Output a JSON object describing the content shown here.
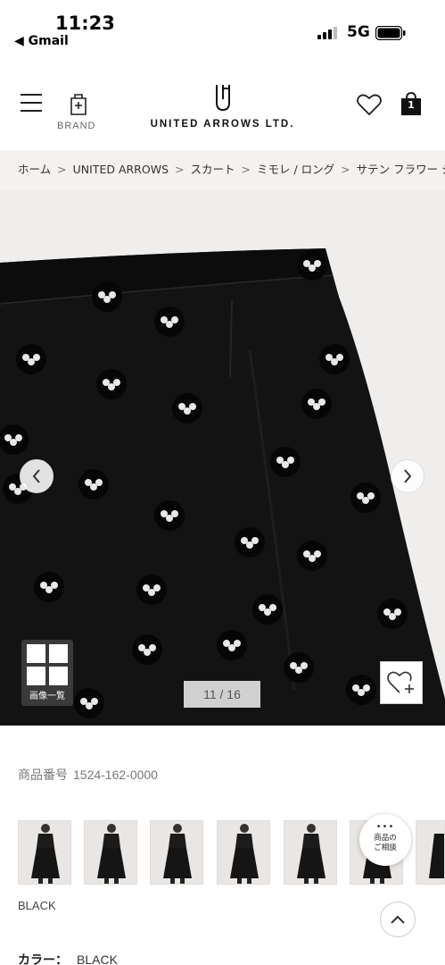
{
  "status_bar": {
    "time": "11:23",
    "back_app": "◀ Gmail",
    "network": "5G"
  },
  "header": {
    "brand_label": "BRAND",
    "logo_text": "UNITED ARROWS LTD.",
    "cart_count": "1"
  },
  "breadcrumb": {
    "items": [
      "ホーム",
      "UNITED ARROWS",
      "スカート",
      "ミモレ / ロング",
      "サテン フラワー ジ"
    ],
    "separator": ">"
  },
  "gallery": {
    "image_list_label": "画像一覧",
    "counter": "11 / 16"
  },
  "product": {
    "number_label": "商品番号",
    "number_value": "1524-162-0000",
    "color_caption": "BLACK",
    "color_label": "カラー：",
    "color_value": "BLACK"
  },
  "consult": {
    "dots": "•••",
    "label_line1": "商品の",
    "label_line2": "ご相談"
  },
  "colors": {
    "breadcrumb_bg": "#f4f1ee",
    "image_bg": "#f0eeec",
    "skirt": "#121212"
  }
}
